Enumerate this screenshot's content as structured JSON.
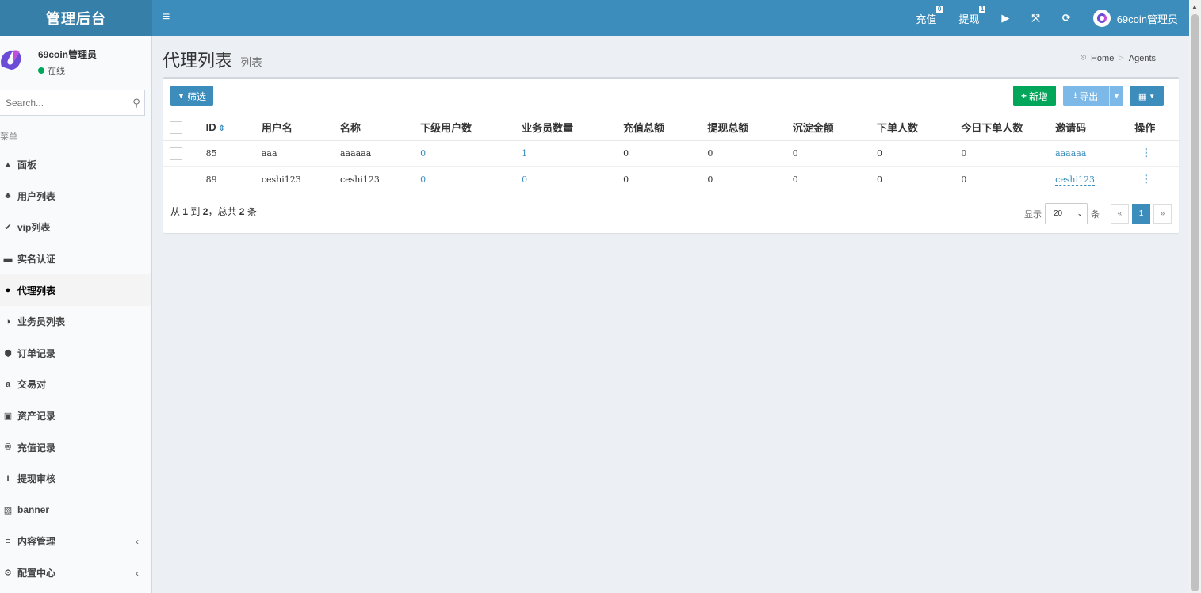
{
  "header": {
    "logo": "管理后台",
    "toggle_icon": "≡",
    "recharge": {
      "label": "充值",
      "badge": "0"
    },
    "withdraw": {
      "label": "提现",
      "badge": "1"
    },
    "username": "69coin管理员"
  },
  "sidebar": {
    "user_name": "69coin管理员",
    "status": "在线",
    "search_placeholder": "Search...",
    "menu_header": "菜单",
    "items": [
      {
        "label": "面板",
        "icon": "area-chart-icon",
        "glyph": "▲"
      },
      {
        "label": "用户列表",
        "icon": "users-icon",
        "glyph": "♣"
      },
      {
        "label": "vip列表",
        "icon": "chevron-circle-icon",
        "glyph": "✔"
      },
      {
        "label": "实名认证",
        "icon": "credit-card-icon",
        "glyph": "▬"
      },
      {
        "label": "代理列表",
        "icon": "caret-circle-up-icon",
        "glyph": "●"
      },
      {
        "label": "业务员列表",
        "icon": "adjust-icon",
        "glyph": "◑"
      },
      {
        "label": "订单记录",
        "icon": "cube-icon",
        "glyph": "⬢"
      },
      {
        "label": "交易对",
        "icon": "amazon-icon",
        "glyph": "a"
      },
      {
        "label": "资产记录",
        "icon": "money-icon",
        "glyph": "▣"
      },
      {
        "label": "充值记录",
        "icon": "registered-icon",
        "glyph": "®"
      },
      {
        "label": "提现审核",
        "icon": "text-height-icon",
        "glyph": "I"
      },
      {
        "label": "banner",
        "icon": "image-icon",
        "glyph": "▨"
      },
      {
        "label": "内容管理",
        "icon": "list-icon",
        "glyph": "≡",
        "caret": "‹"
      },
      {
        "label": "配置中心",
        "icon": "gear-icon",
        "glyph": "⚙",
        "caret": "‹"
      }
    ],
    "active_index": 4
  },
  "content": {
    "title": "代理列表",
    "subtitle": "列表",
    "breadcrumb": {
      "home": "Home",
      "current": "Agents"
    },
    "toolbar": {
      "filter_label": "筛选",
      "add_label": "新增",
      "export_label": "导出"
    },
    "table": {
      "headers": [
        "ID",
        "用户名",
        "名称",
        "下级用户数",
        "业务员数量",
        "充值总额",
        "提现总额",
        "沉淀金额",
        "下单人数",
        "今日下单人数",
        "邀请码",
        "操作"
      ],
      "rows": [
        {
          "id": "85",
          "username": "aaa",
          "name": "aaaaaa",
          "sub_users": "0",
          "salesmen": "1",
          "recharge_total": "0",
          "withdraw_total": "0",
          "deposit": "0",
          "order_users": "0",
          "today_order_users": "0",
          "invite_code": "aaaaaa"
        },
        {
          "id": "89",
          "username": "ceshi123",
          "name": "ceshi123",
          "sub_users": "0",
          "salesmen": "0",
          "recharge_total": "0",
          "withdraw_total": "0",
          "deposit": "0",
          "order_users": "0",
          "today_order_users": "0",
          "invite_code": "ceshi123"
        }
      ]
    },
    "summary": {
      "prefix": "从",
      "from": "1",
      "to_word": "到",
      "to": "2",
      "mid": "，总共",
      "total": "2",
      "suffix": "条"
    },
    "pager": {
      "show_label": "显示",
      "page_size": "20",
      "unit": "条",
      "prev": "«",
      "current": "1",
      "next": "»"
    }
  },
  "colors": {
    "header_bg": "#3c8dbc",
    "logo_bg": "#367fa9",
    "add_button": "#00a65a",
    "export_button": "#7cb9e8",
    "link": "#3c8dbc"
  }
}
